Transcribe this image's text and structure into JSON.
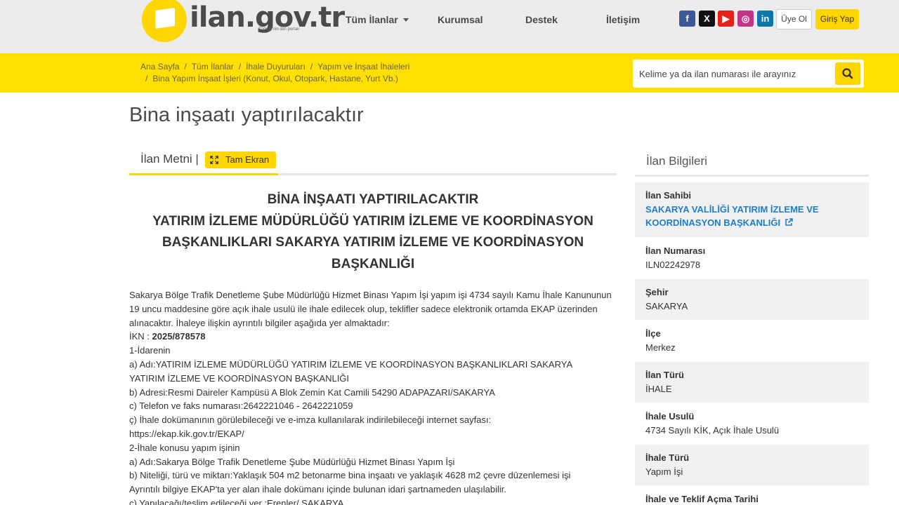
{
  "header": {
    "logo_text": "ilan.gov.tr",
    "logo_tagline": "Türkiye'nin ilan portalı",
    "nav": [
      "Tüm İlanlar",
      "Kurumsal",
      "Destek",
      "İletişim"
    ],
    "social": [
      {
        "name": "facebook",
        "glyph": "f",
        "color": "#3b5998"
      },
      {
        "name": "x",
        "glyph": "X",
        "color": "#111111"
      },
      {
        "name": "youtube",
        "glyph": "▶",
        "color": "#e62117"
      },
      {
        "name": "instagram",
        "glyph": "◎",
        "color": "#c13584"
      },
      {
        "name": "linkedin",
        "glyph": "in",
        "color": "#0e76a8"
      }
    ],
    "signup_label": "Üye Ol",
    "login_label": "Giriş Yap"
  },
  "breadcrumb": {
    "items": [
      "Ana Sayfa",
      "Tüm İlanlar",
      "İhale Duyuruları",
      "Yapım ve İnşaat İhaleleri"
    ],
    "last": "Bina Yapım İnşaat İşleri (Konut, Okul, Otopark, Hastane, Yurt Vb.)"
  },
  "search": {
    "placeholder": "Kelime ya da ilan numarası ile arayınız"
  },
  "page": {
    "title": "Bina inşaatı yaptırılacaktır"
  },
  "tabs": {
    "text_label": "İlan Metni |",
    "fullscreen_label": "Tam Ekran"
  },
  "document": {
    "heading": [
      "BİNA İNŞAATI YAPTIRILACAKTIR",
      "YATIRIM İZLEME MÜDÜRLÜĞÜ YATIRIM İZLEME VE KOORDİNASYON",
      "BAŞKANLIKLARI SAKARYA YATIRIM İZLEME VE KOORDİNASYON",
      "BAŞKANLIĞI"
    ],
    "intro": "Sakarya Bölge Trafik Denetleme Şube Müdürlüğü Hizmet Binası Yapım İşi yapım işi 4734 sayılı Kamu İhale Kanununun 19 uncu maddesine göre açık ihale usulü ile ihale edilecek olup, teklifler sadece elektronik ortamda EKAP üzerinden alınacaktır.  İhaleye ilişkin ayrıntılı bilgiler aşağıda yer almaktadır:",
    "ikn_label": "İKN : ",
    "ikn_value": "2025/878578",
    "lines": [
      "1-İdarenin",
      "a) Adı:YATIRIM İZLEME MÜDÜRLÜĞÜ YATIRIM İZLEME VE KOORDİNASYON BAŞKANLIKLARI SAKARYA",
      "YATIRIM İZLEME VE KOORDİNASYON BAŞKANLIĞI",
      "b) Adresi:Resmi Daireler Kampüsü A Blok Zemin Kat Camili 54290 ADAPAZARI/SAKARYA",
      "c) Telefon ve faks numarası:2642221046 - 2642221059",
      "ç) İhale dokümanının görülebileceği ve e-imza kullanılarak indirilebileceği internet sayfası:",
      " https://ekap.kik.gov.tr/EKAP/",
      "2-İhale konusu yapım işinin",
      "a) Adı:Sakarya Bölge Trafik Denetleme Şube Müdürlüğü Hizmet Binası Yapım İşi",
      "b) Niteliği, türü ve miktarı:Yaklaşık 504 m2 betonarme bina inşaatı ve yaklaşık 4628 m2 çevre düzenlemesi işi",
      "Ayrıntılı bilgiye EKAP'ta yer alan ihale dokümanı içinde bulunan idari şartnameden ulaşılabilir.",
      "c) Yapılacağı/teslim edileceği yer :Erenler/ SAKARYA"
    ]
  },
  "sidebar": {
    "title": "İlan Bilgileri",
    "owner_label": "İlan Sahibi",
    "owner_value": "SAKARYA VALİLİĞİ YATIRIM İZLEME VE KOORDİNASYON BAŞKANLIĞI",
    "fields": [
      {
        "label": "İlan Numarası",
        "value": "ILN02242978"
      },
      {
        "label": "Şehir",
        "value": "SAKARYA"
      },
      {
        "label": "İlçe",
        "value": "Merkez"
      },
      {
        "label": "İlan Türü",
        "value": "İHALE"
      },
      {
        "label": "İhale Usulü",
        "value": "4734 Sayılı KİK, Açık İhale Usulü"
      },
      {
        "label": "İhale Türü",
        "value": "Yapım İşi"
      },
      {
        "label": "İhale ve Teklif Açma Tarihi",
        "value": ""
      }
    ]
  }
}
